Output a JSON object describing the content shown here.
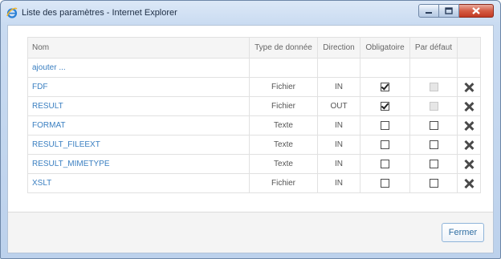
{
  "window": {
    "title": "Liste des paramètres - Internet Explorer"
  },
  "table": {
    "columns": {
      "name": "Nom",
      "type": "Type de donnée",
      "direction": "Direction",
      "required": "Obligatoire",
      "default": "Par défaut"
    },
    "add_label": "ajouter ...",
    "rows": [
      {
        "name": "FDF",
        "type": "Fichier",
        "direction": "IN",
        "required": true,
        "default": false,
        "default_disabled": true
      },
      {
        "name": "RESULT",
        "type": "Fichier",
        "direction": "OUT",
        "required": true,
        "default": false,
        "default_disabled": true
      },
      {
        "name": "FORMAT",
        "type": "Texte",
        "direction": "IN",
        "required": false,
        "default": false,
        "default_disabled": false
      },
      {
        "name": "RESULT_FILEEXT",
        "type": "Texte",
        "direction": "IN",
        "required": false,
        "default": false,
        "default_disabled": false
      },
      {
        "name": "RESULT_MIMETYPE",
        "type": "Texte",
        "direction": "IN",
        "required": false,
        "default": false,
        "default_disabled": false
      },
      {
        "name": "XSLT",
        "type": "Fichier",
        "direction": "IN",
        "required": false,
        "default": false,
        "default_disabled": false
      }
    ]
  },
  "footer": {
    "close_label": "Fermer"
  },
  "icons": {
    "window_icon": "internet-explorer-icon",
    "delete": "close-x-icon"
  }
}
